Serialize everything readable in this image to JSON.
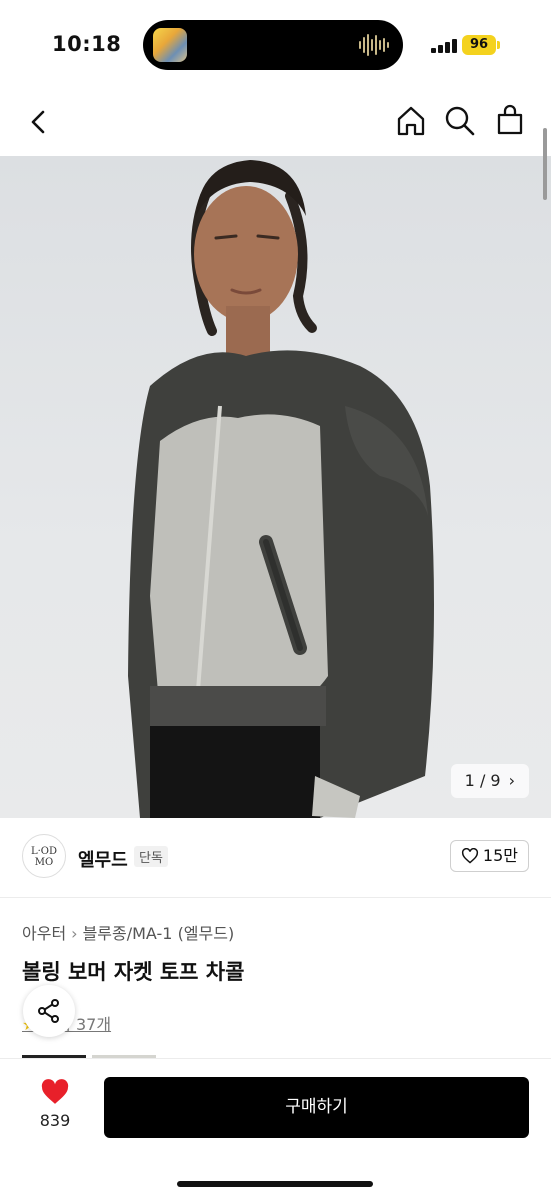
{
  "status_bar": {
    "time": "10:18",
    "battery": "96",
    "icons": [
      "now-playing-icon",
      "audio-wave-icon",
      "signal-icon",
      "battery-icon"
    ]
  },
  "nav": {
    "icons": [
      "back-icon",
      "home-icon",
      "search-icon",
      "cart-icon"
    ]
  },
  "gallery": {
    "counter": "1 / 9",
    "counter_icon": "chevron-right-icon"
  },
  "brand": {
    "logo_text": "L·OD MO",
    "name": "엘무드",
    "badge": "단독",
    "likes": "15만"
  },
  "product": {
    "breadcrumb": [
      "아우터",
      "블루종/MA-1 (엘무드)"
    ],
    "title": "볼링 보머 자켓 토프 차콜",
    "review_text": "후기 37개"
  },
  "bottom_bar": {
    "wish_count": "839",
    "buy_label": "구매하기"
  },
  "colors": {
    "accent": "#000000",
    "heart": "#e8202a",
    "battery": "#f4d21e"
  }
}
